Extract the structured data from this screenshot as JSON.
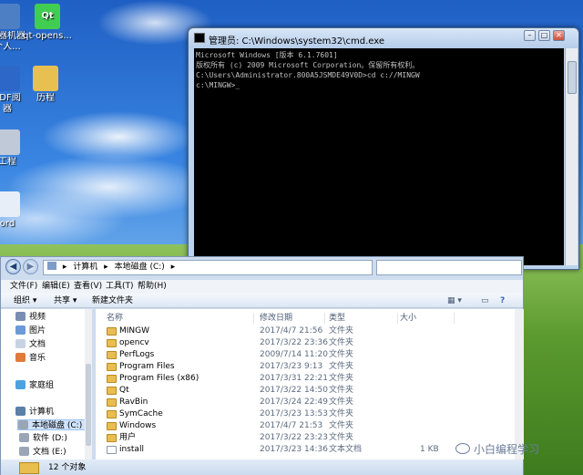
{
  "desktop": {
    "icons": [
      {
        "name": "desktop-icon-1",
        "label_line1": "端器机器",
        "label_line2": "个人...",
        "color": "#4c7fc4"
      },
      {
        "name": "desktop-icon-qt",
        "label_line1": "qt-opens...",
        "label_line2": "",
        "color": "#41cd52"
      },
      {
        "name": "desktop-icon-pdf",
        "label_line1": "PDF阅",
        "label_line2": "器",
        "color": "#2d67c7"
      },
      {
        "name": "desktop-icon-history",
        "label_line1": "历程",
        "label_line2": "",
        "color": "#e8c052"
      },
      {
        "name": "desktop-icon-project",
        "label_line1": "工程",
        "label_line2": "",
        "color": "#c0c9d8"
      },
      {
        "name": "desktop-icon-word",
        "label_line1": "ord",
        "label_line2": "",
        "color": "#e7eef8"
      }
    ]
  },
  "cmd": {
    "title": "管理员: C:\\Windows\\system32\\cmd.exe",
    "lines": [
      "Microsoft Windows [版本 6.1.7601]",
      "版权所有 (c) 2009 Microsoft Corporation。保留所有权利。",
      "",
      "C:\\Users\\Administrator.800A5JSMDE49V0D>cd c://MINGW",
      "",
      "c:\\MINGW>_"
    ]
  },
  "explorer": {
    "breadcrumb": [
      "计算机",
      "▸",
      "本地磁盘 (C:)",
      "▸"
    ],
    "menu": [
      "文件(F)",
      "编辑(E)",
      "查看(V)",
      "工具(T)",
      "帮助(H)"
    ],
    "commands": [
      "组织 ▾",
      "共享 ▾",
      "新建文件夹"
    ],
    "nav_items": [
      {
        "label": "视频",
        "color": "#7a8fb0"
      },
      {
        "label": "图片",
        "color": "#6b9ad6"
      },
      {
        "label": "文档",
        "color": "#c7d2e3"
      },
      {
        "label": "音乐",
        "color": "#e07b3a"
      },
      {
        "label": "家庭组",
        "color": "#4aa3df"
      },
      {
        "label": "计算机",
        "color": "#5c7fa8"
      },
      {
        "label": "本地磁盘 (C:)",
        "color": "#9aa6b6"
      },
      {
        "label": "软件 (D:)",
        "color": "#9aa6b6"
      },
      {
        "label": "文档 (E:)",
        "color": "#9aa6b6"
      }
    ],
    "columns": {
      "name": "名称",
      "date": "修改日期",
      "type": "类型",
      "size": "大小"
    },
    "files": [
      {
        "name": "MINGW",
        "date": "2017/4/7 21:56",
        "type": "文件夹",
        "size": "",
        "kind": "folder"
      },
      {
        "name": "opencv",
        "date": "2017/3/22 23:36",
        "type": "文件夹",
        "size": "",
        "kind": "folder"
      },
      {
        "name": "PerfLogs",
        "date": "2009/7/14 11:20",
        "type": "文件夹",
        "size": "",
        "kind": "folder"
      },
      {
        "name": "Program Files",
        "date": "2017/3/23 9:13",
        "type": "文件夹",
        "size": "",
        "kind": "folder"
      },
      {
        "name": "Program Files (x86)",
        "date": "2017/3/31 22:21",
        "type": "文件夹",
        "size": "",
        "kind": "folder"
      },
      {
        "name": "Qt",
        "date": "2017/3/22 14:50",
        "type": "文件夹",
        "size": "",
        "kind": "folder"
      },
      {
        "name": "RavBin",
        "date": "2017/3/24 22:49",
        "type": "文件夹",
        "size": "",
        "kind": "folder"
      },
      {
        "name": "SymCache",
        "date": "2017/3/23 13:53",
        "type": "文件夹",
        "size": "",
        "kind": "folder"
      },
      {
        "name": "Windows",
        "date": "2017/4/7 21:53",
        "type": "文件夹",
        "size": "",
        "kind": "folder"
      },
      {
        "name": "用户",
        "date": "2017/3/22 23:23",
        "type": "文件夹",
        "size": "",
        "kind": "folder"
      },
      {
        "name": "install",
        "date": "2017/3/23 14:36",
        "type": "文本文档",
        "size": "1 KB",
        "kind": "file"
      }
    ],
    "status": "12 个对象"
  },
  "watermark": "小白编程学习"
}
